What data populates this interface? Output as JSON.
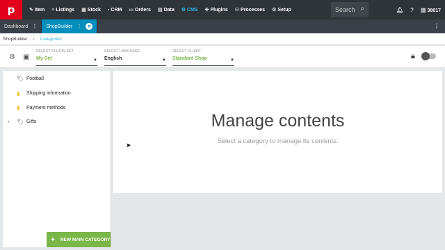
{
  "logo": "p",
  "nav": {
    "items": [
      {
        "icon": "✎",
        "label": "Item"
      },
      {
        "icon": "≡",
        "label": "Listings"
      },
      {
        "icon": "▦",
        "label": "Stock"
      },
      {
        "icon": "▪",
        "label": "CRM"
      },
      {
        "icon": "▭",
        "label": "Orders"
      },
      {
        "icon": "▤",
        "label": "Data"
      },
      {
        "icon": "⚙",
        "label": "CMS"
      },
      {
        "icon": "✚",
        "label": "Plugins"
      },
      {
        "icon": "⚇",
        "label": "Processes"
      },
      {
        "icon": "⚙",
        "label": "Setup"
      }
    ],
    "search_placeholder": "Search",
    "user_id": "38017"
  },
  "tabs": [
    {
      "label": "Dashboard"
    },
    {
      "label": "ShopBuilder"
    }
  ],
  "breadcrumb": {
    "root": "ShopBuilder",
    "separator": "›",
    "current": "Categories"
  },
  "filters": {
    "plugin_set": {
      "label": "SELECT PLUGIN SET",
      "value": "My Set"
    },
    "language": {
      "label": "SELECT LANGUAGE",
      "value": "English"
    },
    "client": {
      "label": "SELECT CLIENT",
      "value": "Standard Shop"
    }
  },
  "tree": {
    "items": [
      {
        "label": "Football",
        "icon": "tag-icon"
      },
      {
        "label": "Shipping information",
        "icon": "folder-icon"
      },
      {
        "label": "Payment methods",
        "icon": "folder-icon"
      },
      {
        "label": "Gifts",
        "icon": "tag-icon"
      }
    ],
    "new_button": "NEW MAIN CATEGORY"
  },
  "main": {
    "title": "Manage contents",
    "subtitle": "Select a category to manage its contents."
  },
  "colors": {
    "brand_red": "#e2001a",
    "accent_blue": "#31b6e7",
    "active_tab": "#008ebd",
    "green": "#7ab648",
    "topbar": "#2f3439"
  }
}
